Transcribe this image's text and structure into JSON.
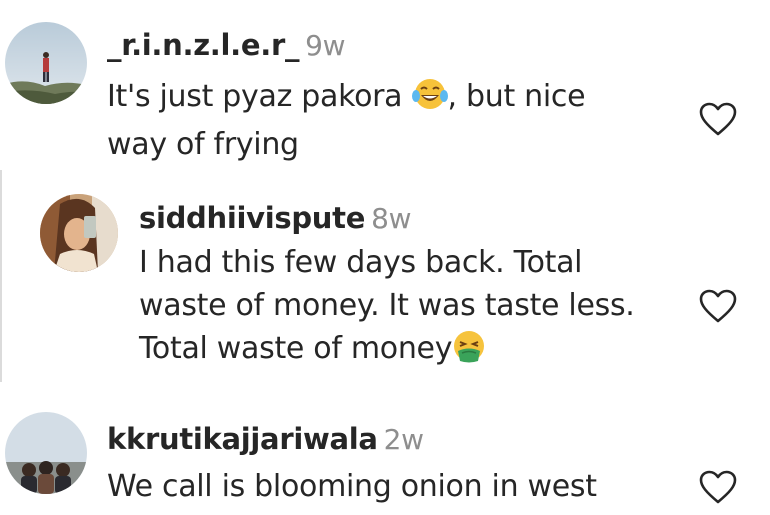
{
  "comments": [
    {
      "username": "_r.i.n.z.l.e.r_",
      "time": "9w",
      "line1_a": "It's just pyaz pakora ",
      "line1_emoji": "face-with-tears-of-joy-emoji",
      "line1_b": ", but nice",
      "line2": "way of frying",
      "like_icon": "heart-outline-icon"
    },
    {
      "username": "siddhiivispute",
      "time": "8w",
      "line1": "I had this few days back. Total",
      "line2": "waste of money. It was taste less.",
      "line3": "Total waste of money",
      "line3_emoji": "nauseated-face-emoji",
      "like_icon": "heart-outline-icon"
    },
    {
      "username": "kkrutikajjariwala",
      "time": "2w",
      "line1": "We call is blooming onion in west",
      "like_icon": "heart-outline-icon"
    }
  ],
  "colors": {
    "text": "#262626",
    "muted": "#8e8e8e",
    "divider": "#dbdbdb"
  }
}
